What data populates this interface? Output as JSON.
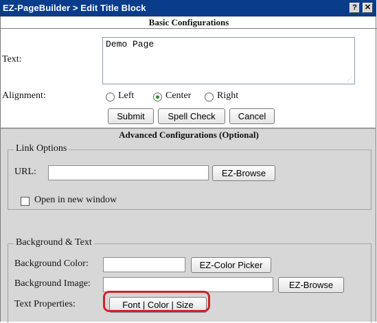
{
  "window": {
    "title": "EZ-PageBuilder > Edit Title Block",
    "help_label": "?",
    "close_label": "✕"
  },
  "basic": {
    "heading": "Basic Configurations",
    "text_label": "Text:",
    "text_value": "Demo Page",
    "alignment_label": "Alignment:",
    "alignment_options": [
      "Left",
      "Center",
      "Right"
    ],
    "alignment_selected": "Center",
    "submit_label": "Submit",
    "spellcheck_label": "Spell Check",
    "cancel_label": "Cancel"
  },
  "advanced": {
    "heading": "Advanced Configurations (Optional)",
    "link_options": {
      "legend": "Link Options",
      "url_label": "URL:",
      "url_value": "",
      "browse_label": "EZ-Browse",
      "new_window_label": "Open in new window",
      "new_window_checked": false
    },
    "background_text": {
      "legend": "Background & Text",
      "bg_color_label": "Background Color:",
      "bg_color_value": "",
      "color_picker_label": "EZ-Color Picker",
      "bg_image_label": "Background Image:",
      "bg_image_value": "",
      "image_browse_label": "EZ-Browse",
      "text_props_label": "Text Properties:",
      "font_button_label": "Font | Color | Size"
    }
  },
  "colors": {
    "titlebar": "#0a3c8c",
    "advanced_bg": "#d7d7d7",
    "highlight": "#d0212a"
  }
}
